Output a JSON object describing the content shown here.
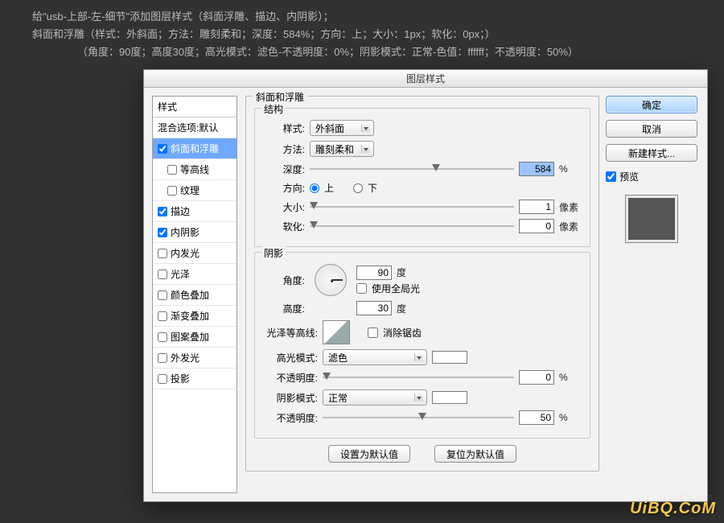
{
  "intro": {
    "line1": "给\"usb-上部-左-细节\"添加图层样式（斜面浮雕、描边、内阴影）；",
    "line2": "斜面和浮雕（样式：外斜面；方法：雕刻柔和；深度：584%；方向：上；大小：1px；软化：0px；）",
    "line3": "（角度：90度；高度30度；高光模式：滤色-不透明度：0%；阴影模式：正常-色值：ffffff；不透明度：50%）"
  },
  "dialog": {
    "title": "图层样式",
    "sidebar": {
      "hdr": "样式",
      "blend": "混合选项:默认",
      "items": [
        {
          "label": "斜面和浮雕",
          "checked": true,
          "selected": true,
          "sub": false
        },
        {
          "label": "等高线",
          "checked": false,
          "selected": false,
          "sub": true
        },
        {
          "label": "纹理",
          "checked": false,
          "selected": false,
          "sub": true
        },
        {
          "label": "描边",
          "checked": true,
          "selected": false,
          "sub": false
        },
        {
          "label": "内阴影",
          "checked": true,
          "selected": false,
          "sub": false
        },
        {
          "label": "内发光",
          "checked": false,
          "selected": false,
          "sub": false
        },
        {
          "label": "光泽",
          "checked": false,
          "selected": false,
          "sub": false
        },
        {
          "label": "颜色叠加",
          "checked": false,
          "selected": false,
          "sub": false
        },
        {
          "label": "渐变叠加",
          "checked": false,
          "selected": false,
          "sub": false
        },
        {
          "label": "图案叠加",
          "checked": false,
          "selected": false,
          "sub": false
        },
        {
          "label": "外发光",
          "checked": false,
          "selected": false,
          "sub": false
        },
        {
          "label": "投影",
          "checked": false,
          "selected": false,
          "sub": false
        }
      ]
    },
    "panel": {
      "title": "斜面和浮雕",
      "structure": {
        "title": "结构",
        "style_label": "样式:",
        "style_value": "外斜面",
        "method_label": "方法:",
        "method_value": "雕刻柔和",
        "depth_label": "深度:",
        "depth_value": "584",
        "depth_unit": "%",
        "dir_label": "方向:",
        "dir_up": "上",
        "dir_down": "下",
        "size_label": "大小:",
        "size_value": "1",
        "size_unit": "像素",
        "soften_label": "软化:",
        "soften_value": "0",
        "soften_unit": "像素"
      },
      "shading": {
        "title": "阴影",
        "angle_label": "角度:",
        "angle_value": "90",
        "angle_unit": "度",
        "global_label": "使用全局光",
        "alt_label": "高度:",
        "alt_value": "30",
        "alt_unit": "度",
        "gloss_label": "光泽等高线:",
        "anti_label": "消除锯齿",
        "hmode_label": "高光模式:",
        "hmode_value": "滤色",
        "hop_label": "不透明度:",
        "hop_value": "0",
        "hop_unit": "%",
        "smode_label": "阴影模式:",
        "smode_value": "正常",
        "sop_label": "不透明度:",
        "sop_value": "50",
        "sop_unit": "%"
      },
      "buttons": {
        "default": "设置为默认值",
        "reset": "复位为默认值"
      }
    },
    "right": {
      "ok": "确定",
      "cancel": "取消",
      "newstyle": "新建样式...",
      "preview_label": "预览"
    }
  },
  "watermark": "UiBQ.CoM",
  "watermark2": "ywwk.psahz.com"
}
